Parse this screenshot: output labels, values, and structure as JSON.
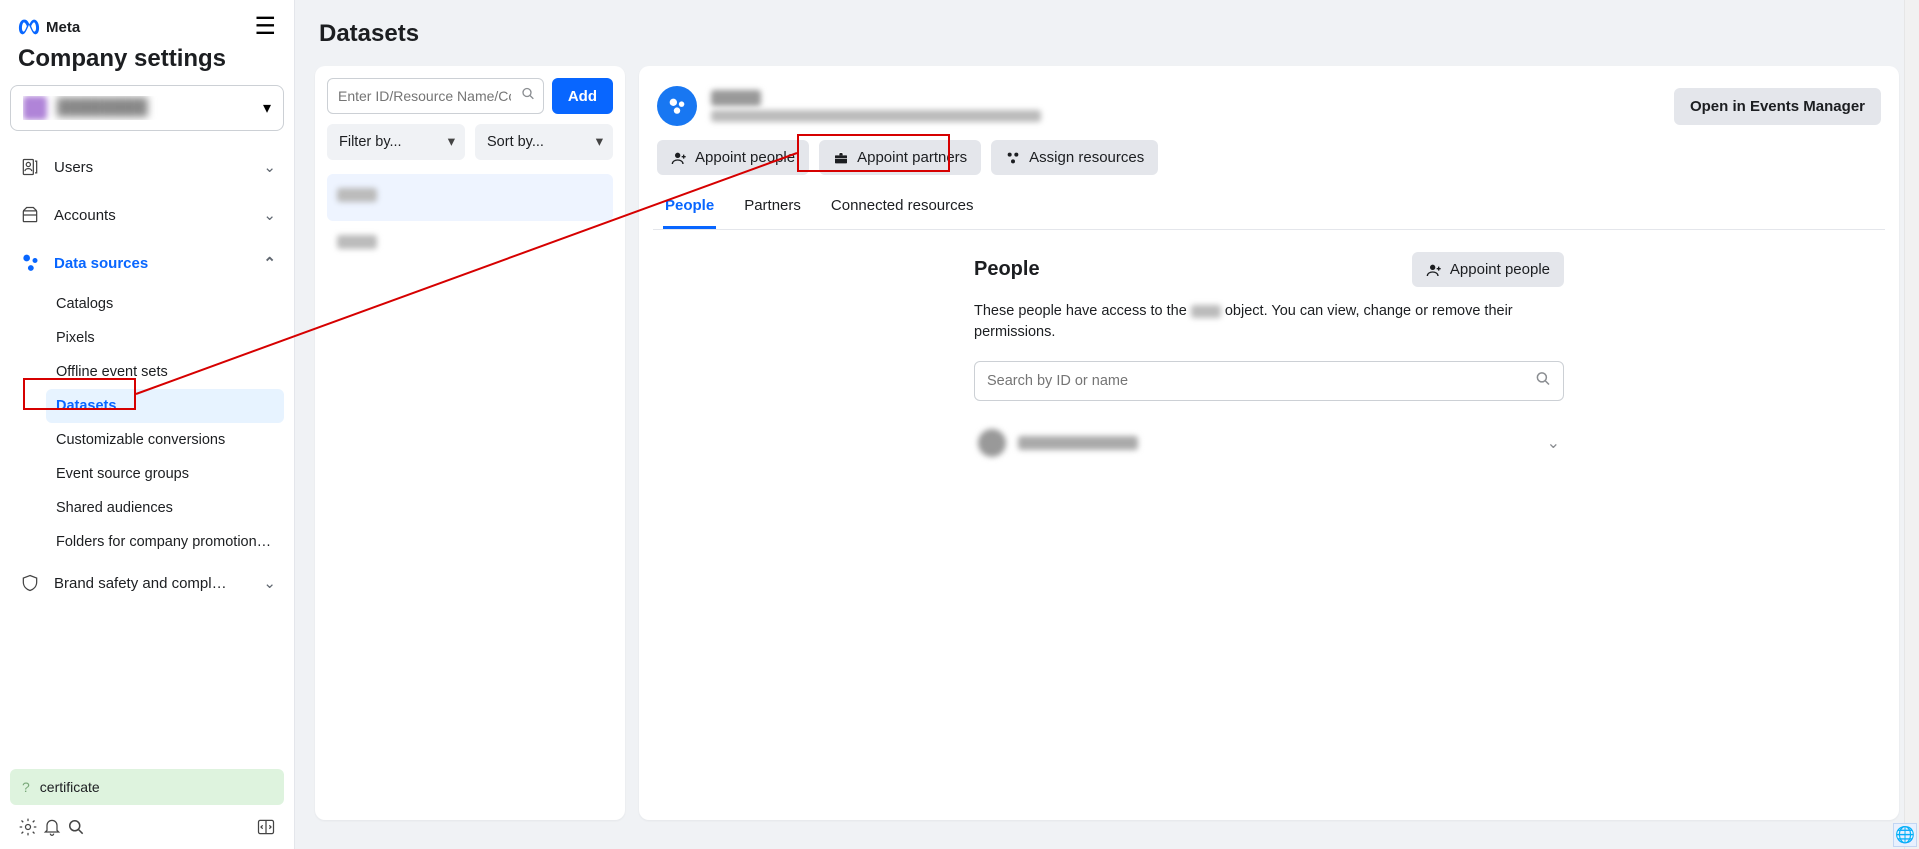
{
  "brand": {
    "name": "Meta"
  },
  "page_title": "Company settings",
  "company_selector_label": "Company Name",
  "nav": {
    "users": "Users",
    "accounts": "Accounts",
    "data_sources": "Data sources",
    "brand_safety": "Brand safety and compl…"
  },
  "data_source_children": {
    "catalogs": "Catalogs",
    "pixels": "Pixels",
    "offline": "Offline event sets",
    "datasets": "Datasets",
    "custom": "Customizable conversions",
    "event_groups": "Event source groups",
    "shared": "Shared audiences",
    "folders": "Folders for company promotional …"
  },
  "footer": {
    "certificate": "certificate"
  },
  "main": {
    "title": "Datasets"
  },
  "list_panel": {
    "search_placeholder": "Enter ID/Resource Name/Co…",
    "add": "Add",
    "filter": "Filter by...",
    "sort": "Sort by..."
  },
  "detail": {
    "open_em": "Open in Events Manager",
    "appoint_people": "Appoint people",
    "appoint_partners": "Appoint partners",
    "assign_resources": "Assign resources"
  },
  "tabs": {
    "people": "People",
    "partners": "Partners",
    "connected": "Connected resources"
  },
  "people_section": {
    "title": "People",
    "appoint_btn": "Appoint people",
    "desc1": "These people have access to the ",
    "desc2": " object. You can view, change or remove their permissions.",
    "search_placeholder": "Search by ID or name"
  }
}
